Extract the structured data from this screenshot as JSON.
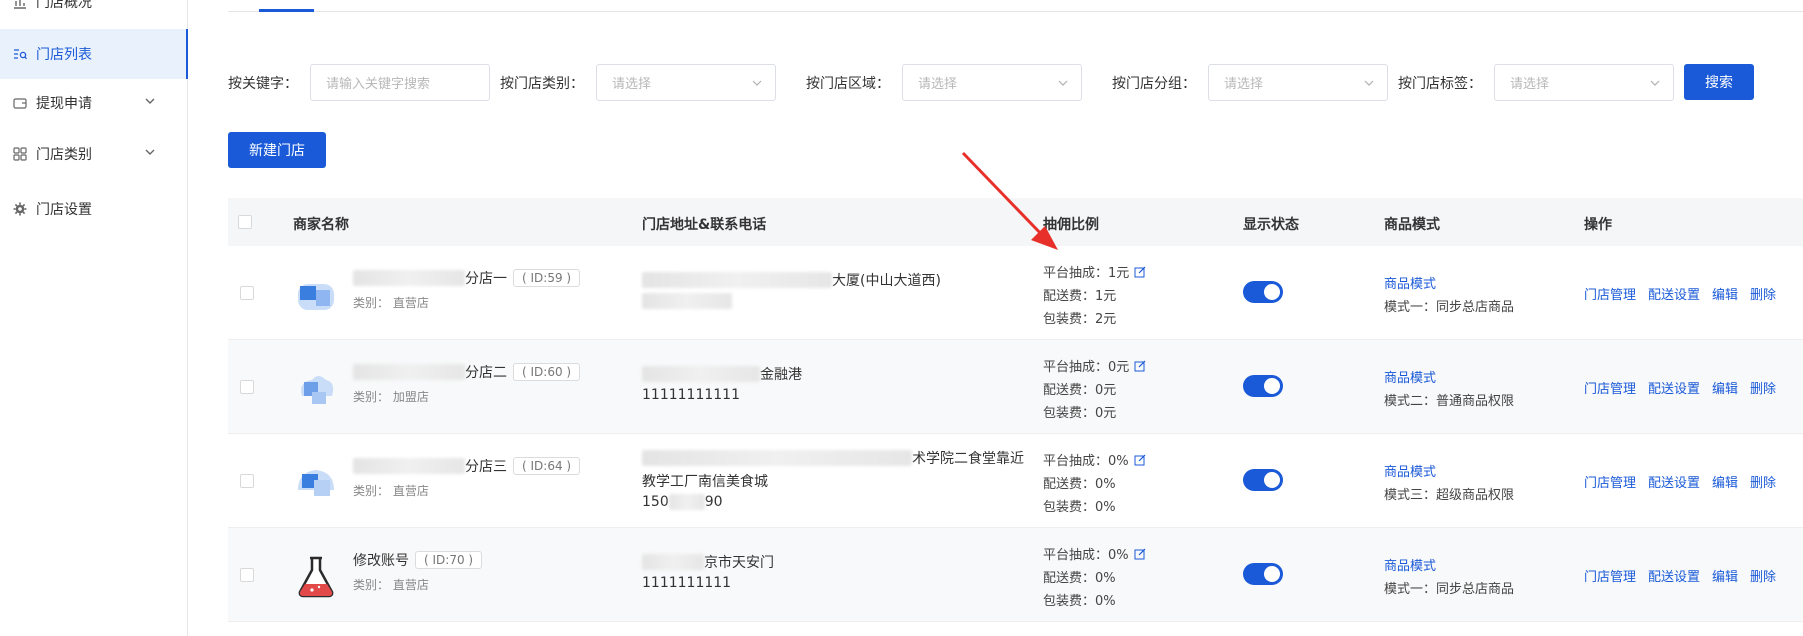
{
  "sidebar": {
    "items": [
      {
        "label": "门店概况",
        "icon": "bar-chart-icon"
      },
      {
        "label": "门店列表",
        "icon": "list-search-icon"
      },
      {
        "label": "提现申请",
        "icon": "wallet-icon"
      },
      {
        "label": "门店类别",
        "icon": "grid-icon"
      },
      {
        "label": "门店设置",
        "icon": "gear-icon"
      }
    ]
  },
  "filters": {
    "keyword_label": "按关键字：",
    "keyword_placeholder": "请输入关键字搜索",
    "category_label": "按门店类别：",
    "region_label": "按门店区域：",
    "group_label": "按门店分组：",
    "tag_label": "按门店标签：",
    "select_placeholder": "请选择",
    "search_button": "搜索"
  },
  "new_store_button": "新建门店",
  "table": {
    "headers": {
      "name": "商家名称",
      "address": "门店地址&联系电话",
      "commission": "抽佣比例",
      "status": "显示状态",
      "mode": "商品模式",
      "actions": "操作"
    },
    "rows": [
      {
        "name_suffix": "分店一",
        "id": "( ID:59 )",
        "category": "类别：  直营店",
        "address_line1": "大厦(中山大道西)",
        "address_line2": "",
        "phone": "",
        "platform": "平台抽成：1元",
        "delivery": "配送费：1元",
        "packing": "包装费：2元",
        "mode_link": "商品模式",
        "mode_desc": "模式一：同步总店商品"
      },
      {
        "name_suffix": "分店二",
        "id": "( ID:60 )",
        "category": "类别：  加盟店",
        "address_line1": "金融港",
        "address_line2": "",
        "phone": "11111111111",
        "platform": "平台抽成：0元",
        "delivery": "配送费：0元",
        "packing": "包装费：0元",
        "mode_link": "商品模式",
        "mode_desc": "模式二：普通商品权限"
      },
      {
        "name_suffix": "分店三",
        "id": "( ID:64 )",
        "category": "类别：  直营店",
        "address_line1": "术学院二食堂靠近",
        "address_line2": "教学工厂南信美食城",
        "phone_prefix": "150",
        "phone_suffix": "90",
        "platform": "平台抽成：0%",
        "delivery": "配送费：0%",
        "packing": "包装费：0%",
        "mode_link": "商品模式",
        "mode_desc": "模式三：超级商品权限"
      },
      {
        "name": "修改账号",
        "id": "( ID:70 )",
        "category": "类别：  直营店",
        "address_line1": "京市天安门",
        "phone": "1111111111",
        "platform": "平台抽成：0%",
        "delivery": "配送费：0%",
        "packing": "包装费：0%",
        "mode_link": "商品模式",
        "mode_desc": "模式一：同步总店商品"
      }
    ],
    "action_labels": [
      "门店管理",
      "配送设置",
      "编辑",
      "删除"
    ]
  },
  "colors": {
    "primary": "#1a5ad8",
    "arrow": "#e8302a"
  }
}
